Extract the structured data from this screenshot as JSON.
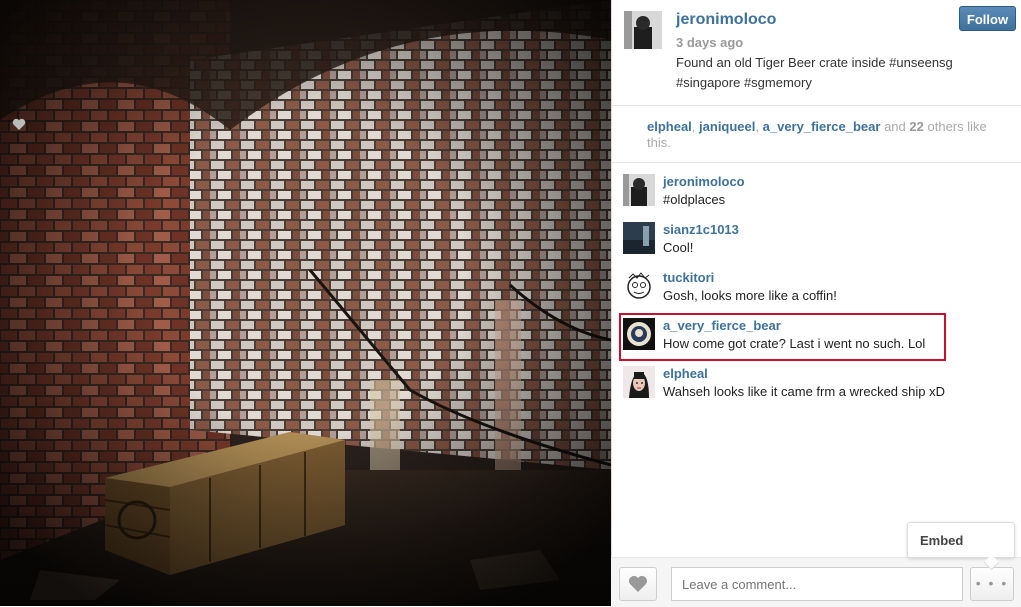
{
  "post": {
    "username": "jeronimoloco",
    "time": "3 days ago",
    "caption": "Found an old Tiger Beer crate inside #unseensg #singapore #sgmemory",
    "follow_label": "Follow"
  },
  "likes": {
    "users": [
      "elpheal",
      "janiqueel",
      "a_very_fierce_bear"
    ],
    "and_text": "and",
    "count": "22",
    "others_text": "others like this."
  },
  "comments": [
    {
      "user": "jeronimoloco",
      "text": "#oldplaces"
    },
    {
      "user": "sianz1c1013",
      "text": "Cool!"
    },
    {
      "user": "tuckitori",
      "text": "Gosh, looks more like a coffin!"
    },
    {
      "user": "a_very_fierce_bear",
      "text": "How come got crate? Last i went no such. Lol"
    },
    {
      "user": "elpheal",
      "text": "Wahseh looks like it came frm a wrecked ship xD"
    }
  ],
  "footer": {
    "comment_placeholder": "Leave a comment...",
    "more_label": "• • •",
    "embed_label": "Embed"
  },
  "icons": {
    "like": "heart-icon",
    "more": "ellipsis-icon"
  },
  "colors": {
    "link": "#3f729b",
    "highlight": "#c8102e"
  }
}
